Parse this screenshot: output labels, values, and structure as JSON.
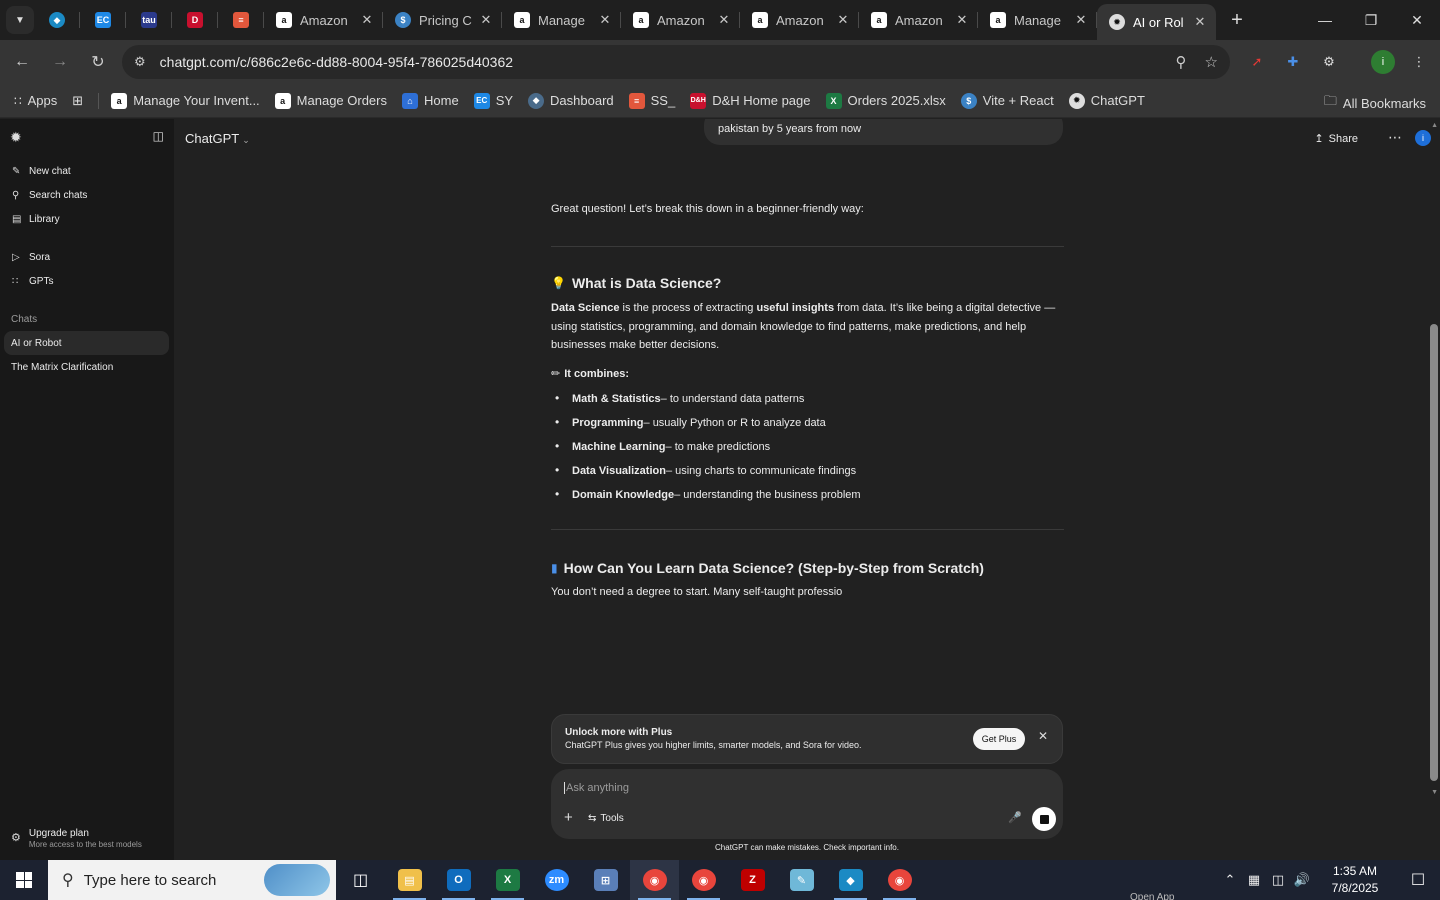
{
  "browser": {
    "pinned_tabs": [
      {
        "icon": "tab-search-icon"
      },
      {
        "icon": "tv-app-icon",
        "color": "#1b8ac4"
      },
      {
        "icon": "ec-icon",
        "label": "EC",
        "color": "#1e88e5"
      },
      {
        "icon": "tau-icon",
        "label": "tau",
        "color": "#2b3a8c"
      },
      {
        "icon": "dh-icon",
        "label": "D&H",
        "color": "#c8102e"
      },
      {
        "icon": "layers-icon",
        "color": "#e2573c"
      }
    ],
    "tabs": [
      {
        "title": "Amazon",
        "icon": "amazon-icon"
      },
      {
        "title": "Pricing C",
        "icon": "dollar-icon"
      },
      {
        "title": "Manage",
        "icon": "amazon-icon"
      },
      {
        "title": "Amazon",
        "icon": "amazon-icon"
      },
      {
        "title": "Amazon",
        "icon": "amazon-icon"
      },
      {
        "title": "Amazon",
        "icon": "amazon-icon"
      },
      {
        "title": "Manage",
        "icon": "amazon-icon"
      },
      {
        "title": "AI or Rol",
        "icon": "chatgpt-icon",
        "active": true
      }
    ],
    "url": "chatgpt.com/c/686c2e6c-dd88-8004-95f4-786025d40362",
    "bookmarks": [
      {
        "label": "Apps",
        "icon": "apps-grid-icon"
      },
      {
        "label": "",
        "icon": "tab-groups-icon"
      },
      {
        "label": "Manage Your Invent...",
        "icon": "amazon-icon"
      },
      {
        "label": "Manage Orders",
        "icon": "amazon-icon"
      },
      {
        "label": "Home",
        "icon": "home-icon"
      },
      {
        "label": "SY",
        "icon": "ec-icon"
      },
      {
        "label": "Dashboard",
        "icon": "dashboard-icon"
      },
      {
        "label": "SS_",
        "icon": "layers-icon"
      },
      {
        "label": "D&H Home page",
        "icon": "dh-icon"
      },
      {
        "label": "Orders 2025.xlsx",
        "icon": "excel-icon"
      },
      {
        "label": "Vite + React",
        "icon": "dollar-icon"
      },
      {
        "label": "ChatGPT",
        "icon": "chatgpt-icon"
      }
    ],
    "all_bookmarks": "All Bookmarks"
  },
  "sidebar": {
    "new_chat": "New chat",
    "search_chats": "Search chats",
    "library": "Library",
    "sora": "Sora",
    "gpts": "GPTs",
    "chats_header": "Chats",
    "chats": [
      "AI or Robot",
      "The Matrix Clarification"
    ],
    "upgrade_title": "Upgrade plan",
    "upgrade_sub": "More access to the best models"
  },
  "header": {
    "model": "ChatGPT",
    "share": "Share",
    "avatar_letter": "i"
  },
  "conversation": {
    "user_message": "pakistan by 5 years from now",
    "intro": "Great question! Let’s break this down in a beginner-friendly way:",
    "h1": "What is Data Science?",
    "para_parts": [
      "Data Science",
      " is the process of extracting ",
      "useful insights",
      " from data. It’s like being a digital detective — using statistics, programming, and domain knowledge to find patterns, make predictions, and help businesses make better decisions."
    ],
    "combines": "It combines:",
    "list": [
      {
        "b": "Math & Statistics",
        "t": " – to understand data patterns"
      },
      {
        "b": "Programming",
        "t": " – usually Python or R to analyze data"
      },
      {
        "b": "Machine Learning",
        "t": " – to make predictions"
      },
      {
        "b": "Data Visualization",
        "t": " – using charts to communicate findings"
      },
      {
        "b": "Domain Knowledge",
        "t": " – understanding the business problem"
      }
    ],
    "h2": "How Can You Learn Data Science? (Step-by-Step from Scratch)",
    "partial": "You don’t need a degree to start. Many self-taught professio"
  },
  "plus_banner": {
    "title": "Unlock more with Plus",
    "subtitle": "ChatGPT Plus gives you higher limits, smarter models, and Sora for video.",
    "button": "Get Plus"
  },
  "composer": {
    "placeholder": "Ask anything",
    "tools": "Tools"
  },
  "disclaimer": "ChatGPT can make mistakes. Check important info.",
  "taskbar": {
    "search_placeholder": "Type here to search",
    "time": "1:35 AM",
    "date": "7/8/2025",
    "open_app": "Open App",
    "apps": [
      {
        "name": "task-view-icon"
      },
      {
        "name": "file-explorer-icon",
        "color": "#f0c04a"
      },
      {
        "name": "outlook-icon",
        "color": "#0f6cbd"
      },
      {
        "name": "excel-icon",
        "color": "#1d7a43"
      },
      {
        "name": "zoom-icon",
        "color": "#2d8cff"
      },
      {
        "name": "calculator-icon",
        "color": "#5a7fb8"
      },
      {
        "name": "chrome-icon",
        "color": "#e8453c"
      },
      {
        "name": "chrome-icon",
        "color": "#e8453c"
      },
      {
        "name": "filezilla-icon",
        "color": "#bf0000"
      },
      {
        "name": "notepad-icon",
        "color": "#6fb8d8"
      },
      {
        "name": "vscode-like-icon",
        "color": "#1b8ac4"
      },
      {
        "name": "chrome-profile-icon",
        "color": "#e8453c"
      }
    ]
  }
}
